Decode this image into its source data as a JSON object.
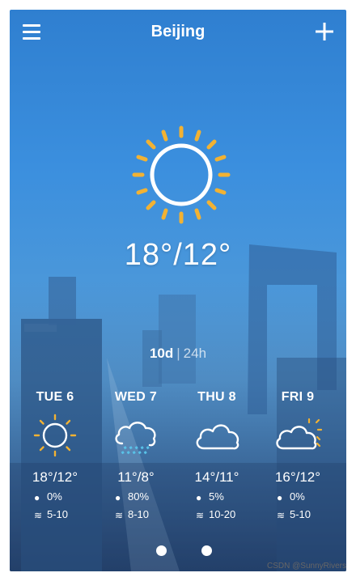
{
  "header": {
    "city": "Beijing",
    "menu_icon": "menu-icon",
    "add_icon": "plus-icon"
  },
  "current": {
    "icon": "sun-icon",
    "temperature": "18°/12°"
  },
  "range_toggle": {
    "options": [
      "10d",
      "24h"
    ],
    "selected": "10d"
  },
  "forecast": [
    {
      "day": "TUE 6",
      "icon": "sun-icon",
      "temperature": "18°/12°",
      "precipitation": "0%",
      "wind": "5-10"
    },
    {
      "day": "WED 7",
      "icon": "rain-cloud-icon",
      "temperature": "11°/8°",
      "precipitation": "80%",
      "wind": "8-10"
    },
    {
      "day": "THU 8",
      "icon": "cloud-icon",
      "temperature": "14°/11°",
      "precipitation": "5%",
      "wind": "10-20"
    },
    {
      "day": "FRI 9",
      "icon": "partly-cloudy-icon",
      "temperature": "16°/12°",
      "precipitation": "0%",
      "wind": "5-10"
    }
  ],
  "pager": {
    "pages": 3,
    "current": 1
  },
  "watermark": "CSDN @SunnyRivers",
  "colors": {
    "sun": "#f2b233",
    "sky_top": "#2f7fd0",
    "sky_bottom": "#2b4e7f",
    "text": "#ffffff"
  }
}
